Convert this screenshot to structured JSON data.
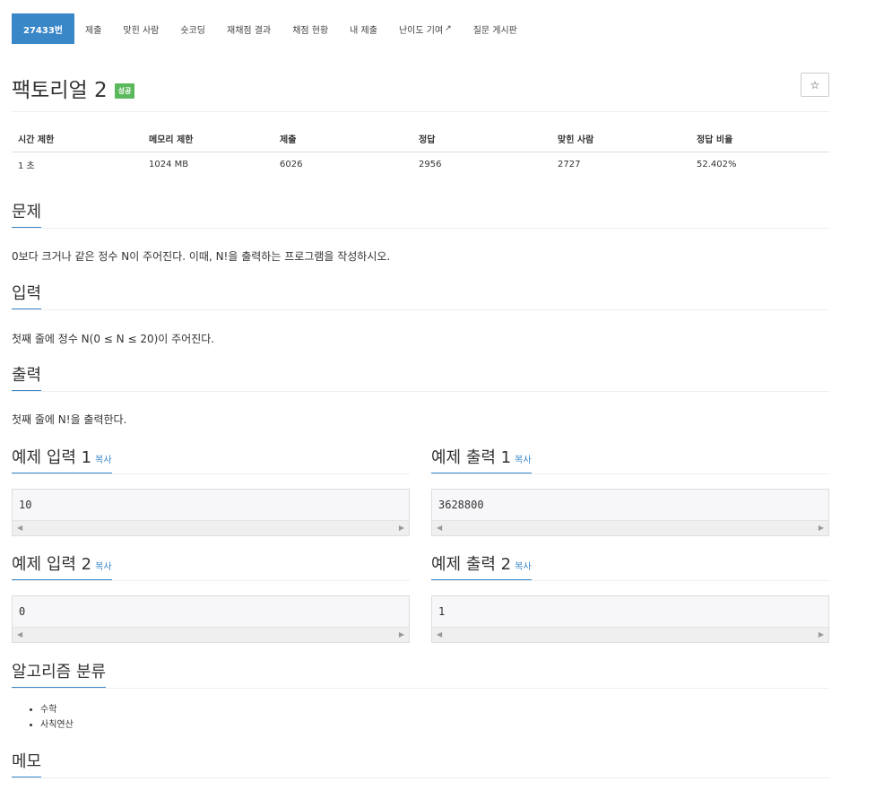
{
  "nav": {
    "tabs": [
      {
        "label": "27433번"
      },
      {
        "label": "제출"
      },
      {
        "label": "맞힌 사람"
      },
      {
        "label": "숏코딩"
      },
      {
        "label": "재채점 결과"
      },
      {
        "label": "채점 현황"
      },
      {
        "label": "내 제출"
      },
      {
        "label": "난이도 기여"
      },
      {
        "label": "질문 게시판"
      }
    ],
    "external_icon": "external-link-icon"
  },
  "problem": {
    "title": "팩토리얼 2",
    "badge": "성공",
    "star": "☆"
  },
  "info_table": {
    "headers": [
      "시간 제한",
      "메모리 제한",
      "제출",
      "정답",
      "맞힌 사람",
      "정답 비율"
    ],
    "values": [
      "1 초",
      "1024 MB",
      "6026",
      "2956",
      "2727",
      "52.402%"
    ]
  },
  "sections": {
    "description": {
      "title": "문제",
      "text": "0보다 크거나 같은 정수 N이 주어진다. 이때, N!을 출력하는 프로그램을 작성하시오."
    },
    "input": {
      "title": "입력",
      "text": "첫째 줄에 정수 N(0 ≤ N ≤ 20)이 주어진다."
    },
    "output": {
      "title": "출력",
      "text": "첫째 줄에 N!을 출력한다."
    }
  },
  "samples": {
    "copy_label": "복사",
    "input1": {
      "title": "예제 입력 1",
      "value": "10"
    },
    "output1": {
      "title": "예제 출력 1",
      "value": "3628800"
    },
    "input2": {
      "title": "예제 입력 2",
      "value": "0"
    },
    "output2": {
      "title": "예제 출력 2",
      "value": "1"
    }
  },
  "algorithm": {
    "title": "알고리즘 분류",
    "items": [
      "수학",
      "사칙연산"
    ]
  },
  "memo": {
    "title": "메모"
  }
}
